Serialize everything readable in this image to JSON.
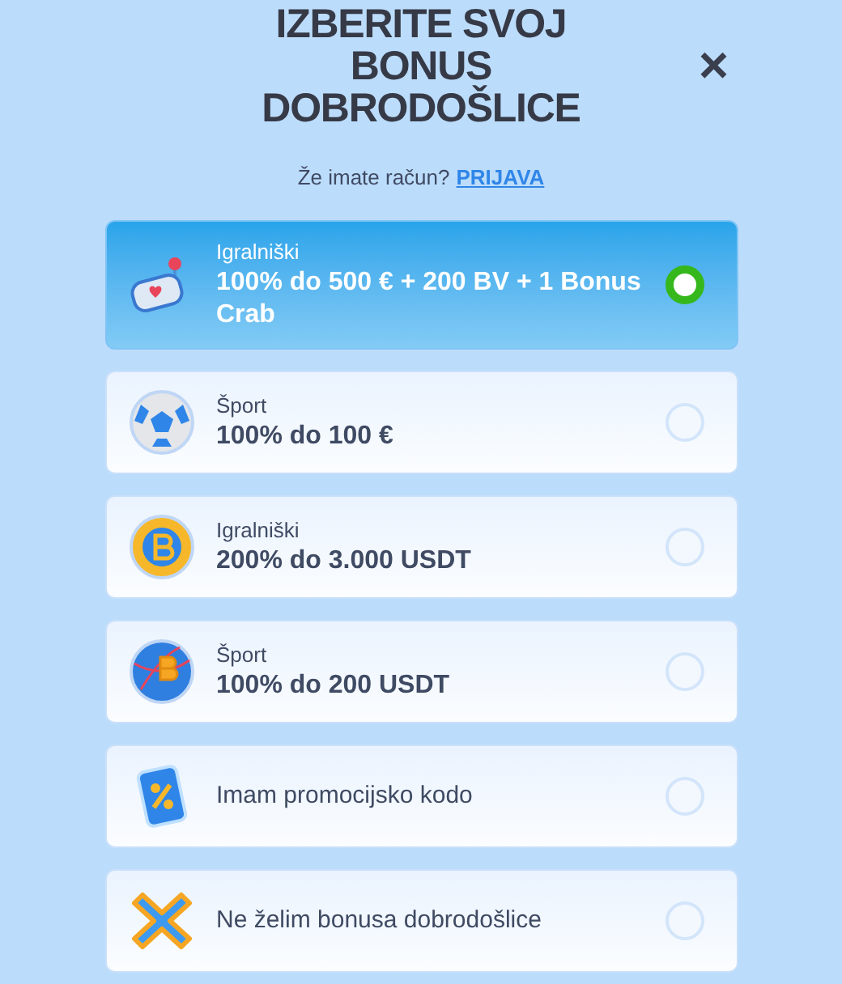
{
  "title": "IZBERITE SVOJ BONUS DOBRODOŠLICE",
  "close": "×",
  "login_prompt": {
    "text": "Že imate račun?",
    "link": "PRIJAVA"
  },
  "options": [
    {
      "kind": "slot",
      "category": "Igralniški",
      "title": "100% do 500 € + 200 BV + 1 Bonus Crab",
      "selected": true
    },
    {
      "kind": "ball",
      "category": "Šport",
      "title": "100% do 100 €",
      "selected": false
    },
    {
      "kind": "coin",
      "category": "Igralniški",
      "title": "200% do 3.000 USDT",
      "selected": false
    },
    {
      "kind": "globe",
      "category": "Šport",
      "title": "100% do 200 USDT",
      "selected": false
    },
    {
      "kind": "ticket",
      "title": "Imam promocijsko kodo",
      "selected": false
    },
    {
      "kind": "cross",
      "title": "Ne želim bonusa dobrodošlice",
      "selected": false
    }
  ]
}
